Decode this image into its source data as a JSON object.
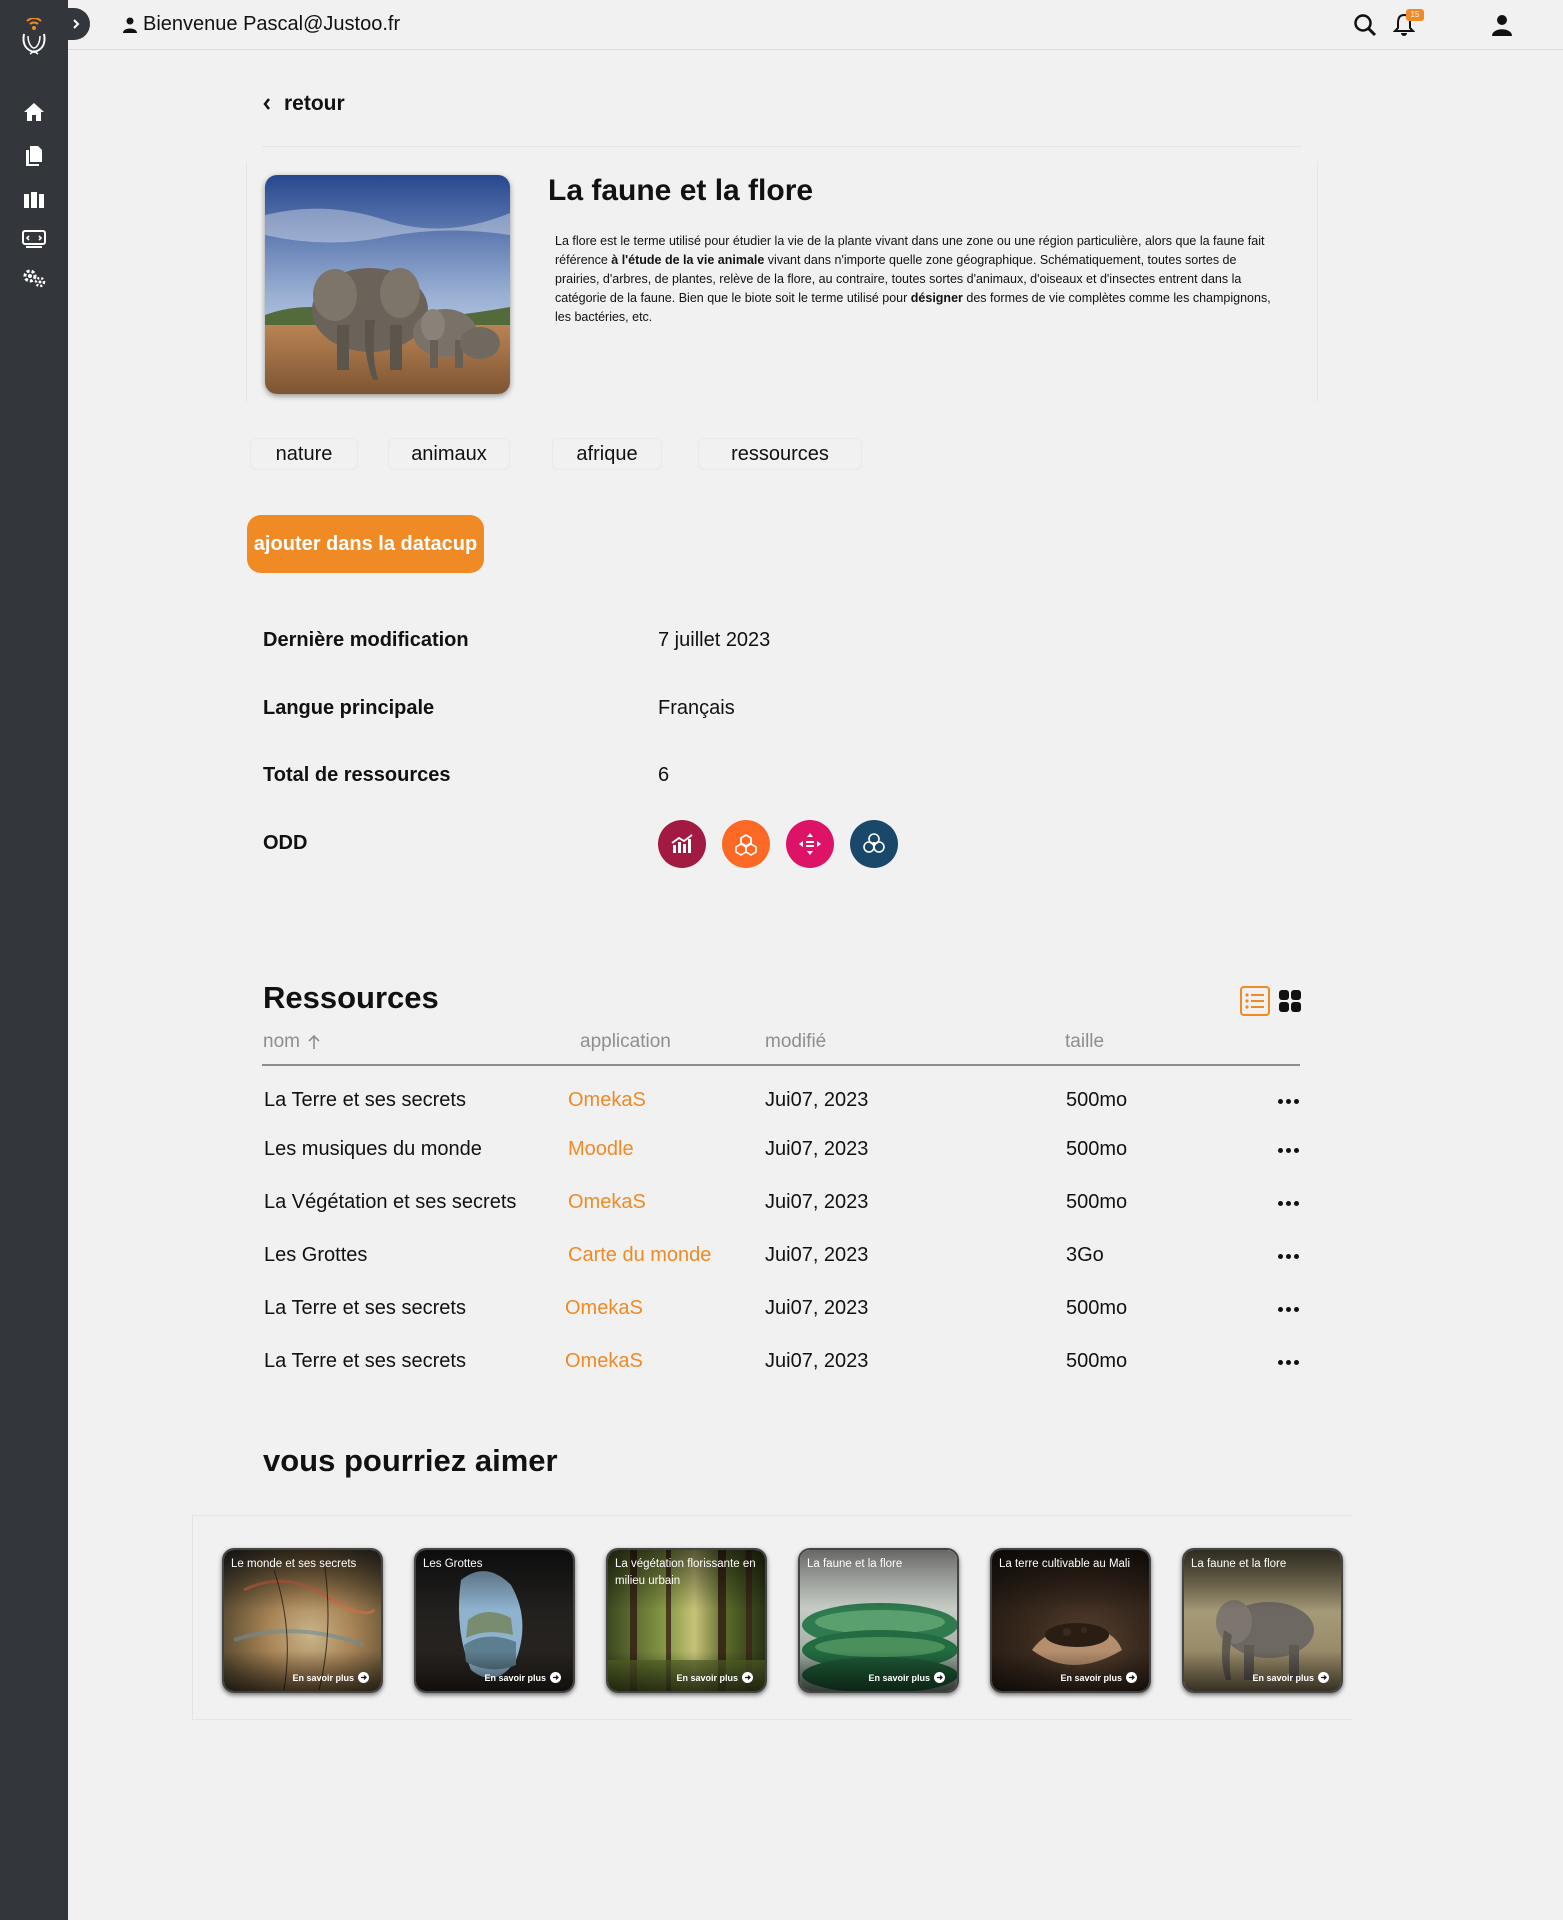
{
  "topbar": {
    "welcome": "Bienvenue Pascal@Justoo.fr",
    "notification_count": "15"
  },
  "sidebar": {
    "items": [
      "home-icon",
      "documents-icon",
      "library-icon",
      "dev-screen-icon",
      "settings-icon"
    ]
  },
  "nav": {
    "back_label": "retour"
  },
  "hero": {
    "title": "La faune et la flore",
    "desc_part1": "La flore est le terme utilisé pour étudier la vie de la plante vivant dans une zone ou une région particulière, alors que la faune fait référence ",
    "desc_bold1": "à l'étude de la vie animale",
    "desc_part2": " vivant dans n'importe quelle zone géographique. Schématiquement, toutes sortes de prairies, d'arbres, de plantes, relève de la flore, au contraire, toutes sortes d'animaux, d'oiseaux et d'insectes entrent dans la catégorie de la faune. Bien que le biote soit le terme utilisé pour ",
    "desc_bold2": "désigner",
    "desc_part3": " des formes de vie complètes comme les champignons, les bactéries, etc."
  },
  "tags": [
    "nature",
    "animaux",
    "afrique",
    "ressources"
  ],
  "add_button": "ajouter dans la datacup",
  "info": {
    "last_modified_label": "Dernière modification",
    "last_modified_value": "7 juillet 2023",
    "language_label": "Langue principale",
    "language_value": "Français",
    "total_label": "Total de ressources",
    "total_value": "6",
    "odd_label": "ODD"
  },
  "odd_colors": [
    "#a21942",
    "#fd6925",
    "#dd1367",
    "#19486a"
  ],
  "resources": {
    "title": "Ressources",
    "columns": [
      "nom",
      "application",
      "modifié",
      "taille"
    ],
    "rows": [
      {
        "name": "La Terre et ses secrets",
        "app": "OmekaS",
        "date": "Jui07, 2023",
        "size": "500mo"
      },
      {
        "name": "Les musiques du monde",
        "app": "Moodle",
        "date": "Jui07, 2023",
        "size": "500mo"
      },
      {
        "name": "La Végétation et ses secrets",
        "app": "OmekaS",
        "date": "Jui07, 2023",
        "size": "500mo"
      },
      {
        "name": "Les Grottes",
        "app": "Carte du monde",
        "date": "Jui07, 2023",
        "size": "3Go"
      },
      {
        "name": "La Terre et ses secrets",
        "app": "OmekaS",
        "date": "Jui07, 2023",
        "size": "500mo"
      },
      {
        "name": "La Terre et ses secrets",
        "app": "OmekaS",
        "date": "Jui07, 2023",
        "size": "500mo"
      }
    ]
  },
  "recommendations": {
    "title": "vous pourriez aimer",
    "more_label": "En savoir plus",
    "cards": [
      {
        "title": "Le monde et ses secrets"
      },
      {
        "title": "Les Grottes"
      },
      {
        "title": "La végétation florissante en milieu urbain"
      },
      {
        "title": "La faune et la flore"
      },
      {
        "title": "La terre cultivable au Mali"
      },
      {
        "title": "La faune et la flore"
      }
    ]
  }
}
